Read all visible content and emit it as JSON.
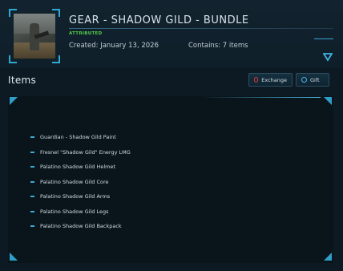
{
  "header": {
    "title": "GEAR - SHADOW GILD - BUNDLE",
    "badge": "ATTRIBUTED",
    "created": "Created: January 13, 2026",
    "contains": "Contains: 7 items",
    "expand_icon": "chevron-down-triangle"
  },
  "section": {
    "title": "Items",
    "exchange_label": "Exchange",
    "gift_label": "Gift"
  },
  "items": [
    "Guardian - Shadow Gild Paint",
    "Fresnel \"Shadow Gild\" Energy LMG",
    "Palatino Shadow Gild Helmet",
    "Palatino Shadow Gild Core",
    "Palatino Shadow Gild Arms",
    "Palatino Shadow Gild Legs",
    "Palatino Shadow Gild Backpack"
  ],
  "colors": {
    "accent": "#2fa8d6",
    "badge": "#55d04a",
    "exchange_icon": "#e03a3a",
    "background": "#0d1a24"
  }
}
